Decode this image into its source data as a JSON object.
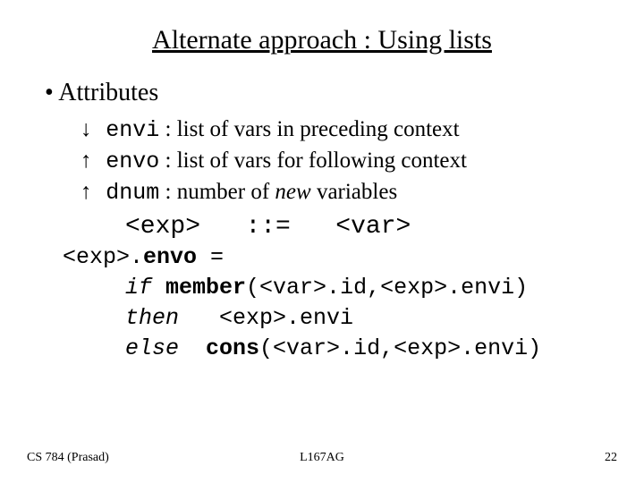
{
  "title": "Alternate approach : Using lists",
  "bullet": "Attributes",
  "attrs": {
    "envi": {
      "arrow": "↓",
      "name": "envi",
      "desc": " : list of vars in preceding context"
    },
    "envo": {
      "arrow": "↑",
      "name": "envo",
      "desc": " : list of vars for following context"
    },
    "dnum": {
      "arrow": "↑",
      "name": "dnum",
      "desc_pre": " : number of ",
      "desc_em": "new",
      "desc_post": " variables"
    }
  },
  "grammar": {
    "lhs": "<exp>",
    "op": "::=",
    "rhs": "<var>"
  },
  "code": {
    "l1a": "<exp>.",
    "l1b": "envo",
    "l1c": " =",
    "l2kw": "if",
    "l2f": "member",
    "l2args": "(<var>.id,<exp>.envi)",
    "l3kw": "then",
    "l3v": "<exp>.envi",
    "l4kw": "else",
    "l4f": "cons",
    "l4args": "(<var>.id,<exp>.envi)"
  },
  "footer": {
    "left": "CS 784 (Prasad)",
    "center": "L167AG",
    "right": "22"
  }
}
